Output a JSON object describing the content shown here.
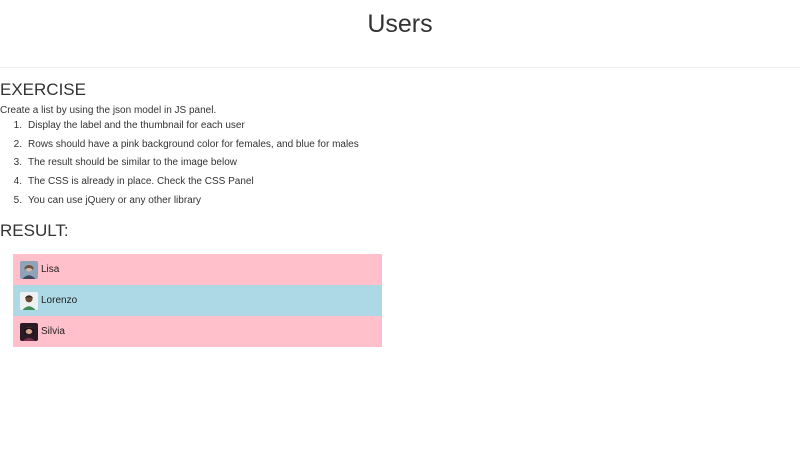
{
  "header": {
    "title": "Users"
  },
  "exercise": {
    "heading": "EXERCISE",
    "intro": "Create a list by using the json model in JS panel.",
    "steps": [
      {
        "number": "1.",
        "text": "Display the label and the thumbnail for each user"
      },
      {
        "number": "2.",
        "text": "Rows should have a pink background color for females, and blue for males"
      },
      {
        "number": "3.",
        "text": "The result should be similar to the image below"
      },
      {
        "number": "4.",
        "text": "The CSS is already in place. Check the CSS Panel"
      },
      {
        "number": "5.",
        "text": "You can use jQuery or any other library"
      }
    ]
  },
  "result": {
    "heading": "RESULT:",
    "users": [
      {
        "label": "Lisa",
        "gender": "female",
        "row_color": "#ffc0cb",
        "thumbnail": "avatar-icon"
      },
      {
        "label": "Lorenzo",
        "gender": "male",
        "row_color": "#add8e6",
        "thumbnail": "avatar-icon"
      },
      {
        "label": "Silvia",
        "gender": "female",
        "row_color": "#ffc0cb",
        "thumbnail": "avatar-icon"
      }
    ]
  }
}
